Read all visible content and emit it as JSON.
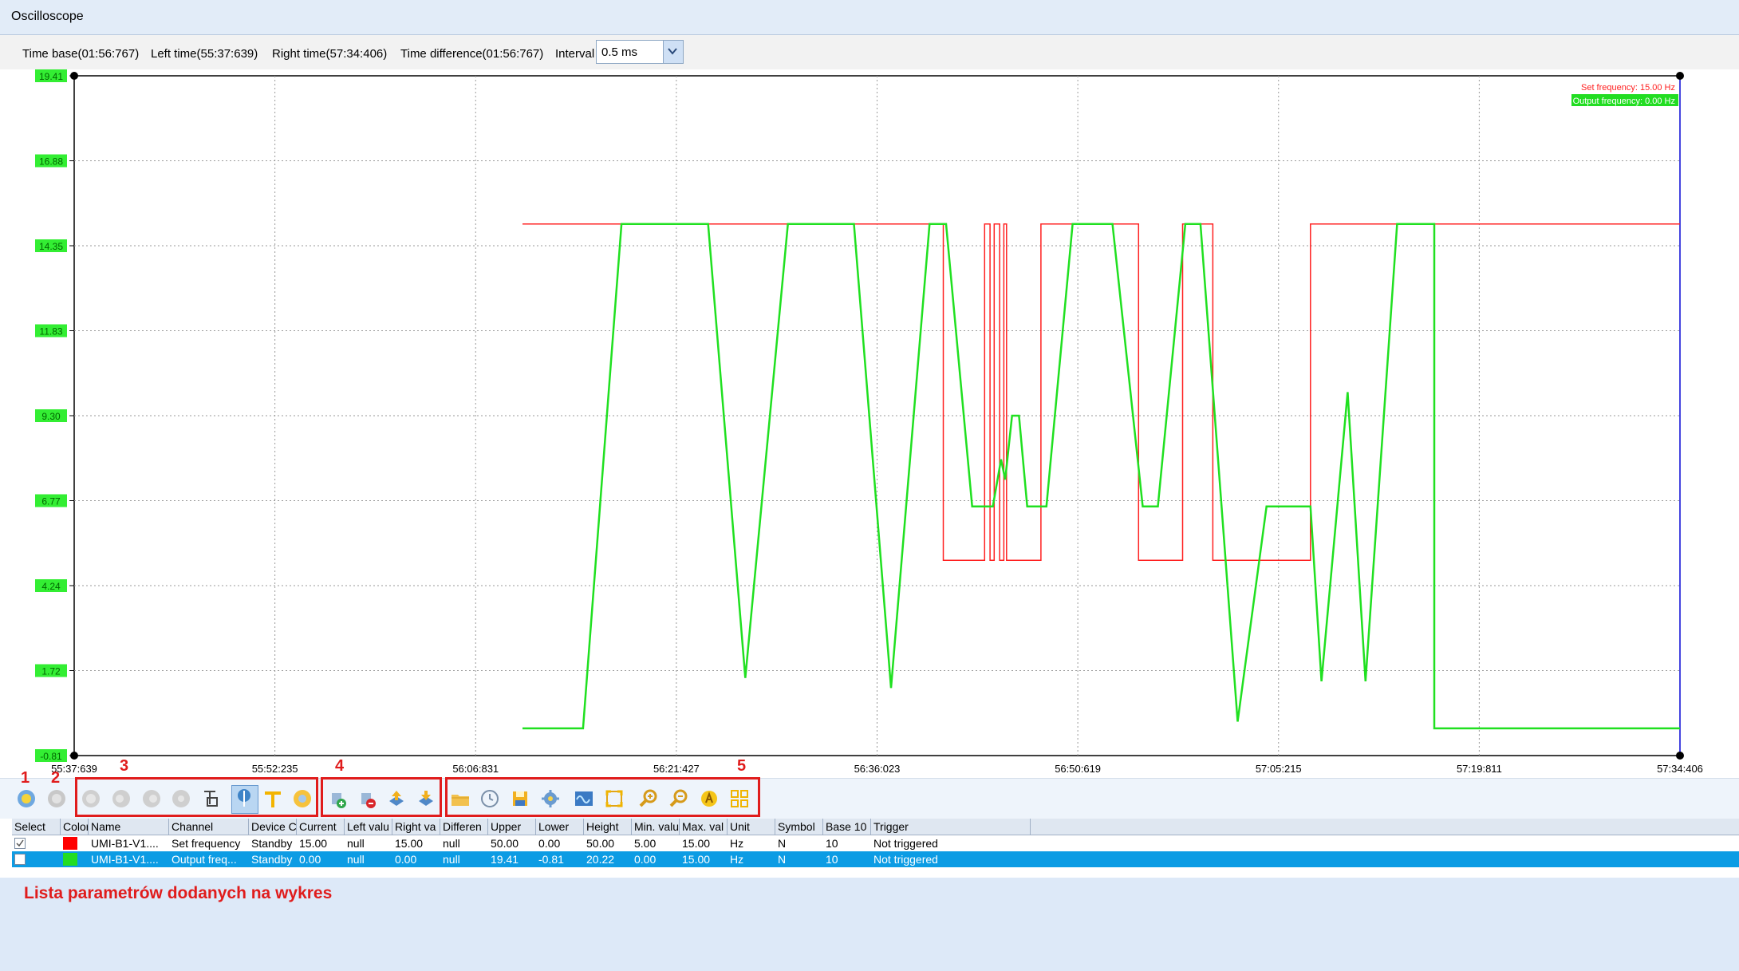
{
  "window": {
    "title": "Oscilloscope"
  },
  "info": {
    "time_base": "Time base(01:56:767)",
    "left_time": "Left time(55:37:639)",
    "right_time": "Right time(57:34:406)",
    "time_difference": "Time difference(01:56:767)",
    "interval_label": "Interval",
    "interval_value": "0.5 ms"
  },
  "chart_data": {
    "type": "line",
    "x_tick_labels": [
      "55:37:639",
      "55:52:235",
      "56:06:831",
      "56:21:427",
      "56:36:023",
      "56:50:619",
      "57:05:215",
      "57:19:811",
      "57:34:406"
    ],
    "y_tick_labels": [
      "19.41",
      "16.88",
      "14.35",
      "11.83",
      "9.30",
      "6.77",
      "4.24",
      "1.72",
      "-0.81"
    ],
    "ylim": [
      -0.81,
      19.41
    ],
    "xlim": [
      0,
      116.767
    ],
    "grid": true,
    "legend_position": "top-right",
    "series": [
      {
        "name": "Set frequency: 15.00 Hz",
        "color": "#ff2020",
        "points": [
          [
            32.6,
            15.0
          ],
          [
            63.2,
            15.0
          ],
          [
            63.2,
            5.0
          ],
          [
            66.2,
            5.0
          ],
          [
            66.2,
            15.0
          ],
          [
            66.6,
            15.0
          ],
          [
            66.6,
            5.0
          ],
          [
            66.9,
            5.0
          ],
          [
            66.9,
            15.0
          ],
          [
            67.3,
            15.0
          ],
          [
            67.3,
            5.0
          ],
          [
            67.6,
            5.0
          ],
          [
            67.6,
            15.0
          ],
          [
            67.8,
            15.0
          ],
          [
            67.8,
            5.0
          ],
          [
            70.3,
            5.0
          ],
          [
            70.3,
            15.0
          ],
          [
            77.4,
            15.0
          ],
          [
            77.4,
            5.0
          ],
          [
            80.6,
            5.0
          ],
          [
            80.6,
            15.0
          ],
          [
            82.8,
            15.0
          ],
          [
            82.8,
            5.0
          ],
          [
            89.9,
            5.0
          ],
          [
            89.9,
            15.0
          ],
          [
            116.767,
            15.0
          ]
        ]
      },
      {
        "name": "Output frequency: 0.00 Hz",
        "color": "#20e020",
        "points": [
          [
            32.6,
            0.0
          ],
          [
            37.0,
            0.0
          ],
          [
            39.8,
            15.0
          ],
          [
            46.1,
            15.0
          ],
          [
            48.8,
            1.5
          ],
          [
            51.9,
            15.0
          ],
          [
            56.7,
            15.0
          ],
          [
            59.4,
            1.2
          ],
          [
            62.2,
            15.0
          ],
          [
            63.4,
            15.0
          ],
          [
            65.3,
            6.6
          ],
          [
            66.8,
            6.6
          ],
          [
            67.4,
            8.0
          ],
          [
            67.7,
            7.4
          ],
          [
            68.2,
            9.3
          ],
          [
            68.7,
            9.3
          ],
          [
            69.3,
            6.6
          ],
          [
            70.7,
            6.6
          ],
          [
            72.6,
            15.0
          ],
          [
            75.5,
            15.0
          ],
          [
            77.7,
            6.6
          ],
          [
            78.8,
            6.6
          ],
          [
            80.8,
            15.0
          ],
          [
            81.9,
            15.0
          ],
          [
            84.6,
            0.2
          ],
          [
            86.7,
            6.6
          ],
          [
            89.9,
            6.6
          ],
          [
            90.7,
            1.4
          ],
          [
            92.6,
            10.0
          ],
          [
            93.9,
            1.4
          ],
          [
            96.2,
            15.0
          ],
          [
            98.9,
            15.0
          ],
          [
            98.9,
            0.0
          ],
          [
            116.767,
            0.0
          ]
        ]
      }
    ]
  },
  "annotations": {
    "n1": "1",
    "n2": "2",
    "n3": "3",
    "n4": "4",
    "n5": "5"
  },
  "table": {
    "columns": [
      "Select",
      "Color",
      "Name",
      "Channel",
      "Device C",
      "Current",
      "Left valu",
      "Right va",
      "Differen",
      "Upper",
      "Lower",
      "Height",
      "Min. valu",
      "Max. val",
      "Unit",
      "Symbol",
      "Base 10",
      "Trigger"
    ],
    "rows": [
      {
        "name": "UMI-B1-V1....",
        "channel": "Set frequency",
        "device": "Standby",
        "current": "15.00",
        "left": "null",
        "right": "15.00",
        "diff": "null",
        "upper": "50.00",
        "lower": "0.00",
        "height": "50.00",
        "min": "5.00",
        "max": "15.00",
        "unit": "Hz",
        "symbol": "N",
        "base": "10",
        "trigger": "Not triggered",
        "color": "#ff0000"
      },
      {
        "name": "UMI-B1-V1....",
        "channel": "Output freq...",
        "device": "Standby",
        "current": "0.00",
        "left": "null",
        "right": "0.00",
        "diff": "null",
        "upper": "19.41",
        "lower": "-0.81",
        "height": "20.22",
        "min": "0.00",
        "max": "15.00",
        "unit": "Hz",
        "symbol": "N",
        "base": "10",
        "trigger": "Not triggered",
        "color": "#22dd22"
      }
    ]
  },
  "footer_note": "Lista parametrów dodanych na wykres",
  "icons": [
    "play-icon",
    "stop-icon",
    "channel-1-icon",
    "channel-2-icon",
    "channel-3-icon",
    "channel-4-icon",
    "hand-pointer-icon",
    "cursor-select-icon",
    "text-tool-icon",
    "marker-icon",
    "add-channel-icon",
    "remove-channel-icon",
    "upload-icon",
    "download-icon",
    "open-folder-icon",
    "history-icon",
    "save-icon",
    "settings-icon",
    "waveform-icon",
    "fit-screen-icon",
    "zoom-in-icon",
    "zoom-out-icon",
    "auto-scale-icon",
    "grid-layout-icon"
  ]
}
